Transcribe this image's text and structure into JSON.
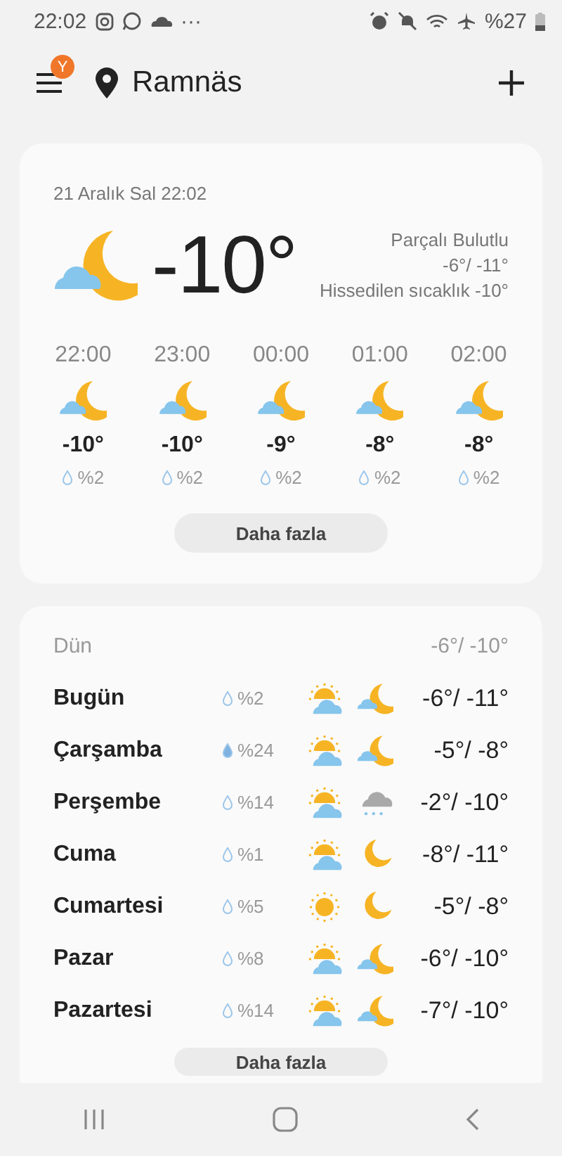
{
  "status_bar": {
    "time": "22:02",
    "more": "···",
    "battery": "%27"
  },
  "header": {
    "badge": "Y",
    "location": "Ramnäs"
  },
  "current": {
    "datetime": "21 Aralık Sal 22:02",
    "kind": "night-cloud",
    "temperature": "-10°",
    "condition": "Parçalı Bulutlu",
    "range": "-6°/ -11°",
    "feels_like": "Hissedilen sıcaklık -10°",
    "hourly": [
      {
        "time": "22:00",
        "kind": "night-cloud",
        "temperature": "-10°",
        "precip": "%2"
      },
      {
        "time": "23:00",
        "kind": "night-cloud",
        "temperature": "-10°",
        "precip": "%2"
      },
      {
        "time": "00:00",
        "kind": "night-cloud",
        "temperature": "-9°",
        "precip": "%2"
      },
      {
        "time": "01:00",
        "kind": "night-cloud",
        "temperature": "-8°",
        "precip": "%2"
      },
      {
        "time": "02:00",
        "kind": "night-cloud",
        "temperature": "-8°",
        "precip": "%2"
      }
    ],
    "more_button": "Daha fazla"
  },
  "daily": {
    "yesterday": {
      "label": "Dün",
      "range": "-6°/ -10°"
    },
    "days": [
      {
        "day": "Bugün",
        "precip": "%2",
        "icons": [
          {
            "kind": "sun-cloud"
          },
          {
            "kind": "night-cloud"
          }
        ],
        "range": "-6°/ -11°"
      },
      {
        "day": "Çarşamba",
        "precip": "%24",
        "icons": [
          {
            "kind": "sun-cloud"
          },
          {
            "kind": "night-cloud"
          }
        ],
        "range": "-5°/ -8°"
      },
      {
        "day": "Perşembe",
        "precip": "%14",
        "icons": [
          {
            "kind": "sun-cloud"
          },
          {
            "kind": "snow-cloud"
          }
        ],
        "range": "-2°/ -10°"
      },
      {
        "day": "Cuma",
        "precip": "%1",
        "icons": [
          {
            "kind": "sun-cloud"
          },
          {
            "kind": "moon"
          }
        ],
        "range": "-8°/ -11°"
      },
      {
        "day": "Cumartesi",
        "precip": "%5",
        "icons": [
          {
            "kind": "sun"
          },
          {
            "kind": "moon"
          }
        ],
        "range": "-5°/ -8°"
      },
      {
        "day": "Pazar",
        "precip": "%8",
        "icons": [
          {
            "kind": "sun-cloud"
          },
          {
            "kind": "night-cloud"
          }
        ],
        "range": "-6°/ -10°"
      },
      {
        "day": "Pazartesi",
        "precip": "%14",
        "icons": [
          {
            "kind": "sun-cloud"
          },
          {
            "kind": "night-cloud"
          }
        ],
        "range": "-7°/ -10°"
      }
    ],
    "more_button": "Daha fazla"
  }
}
